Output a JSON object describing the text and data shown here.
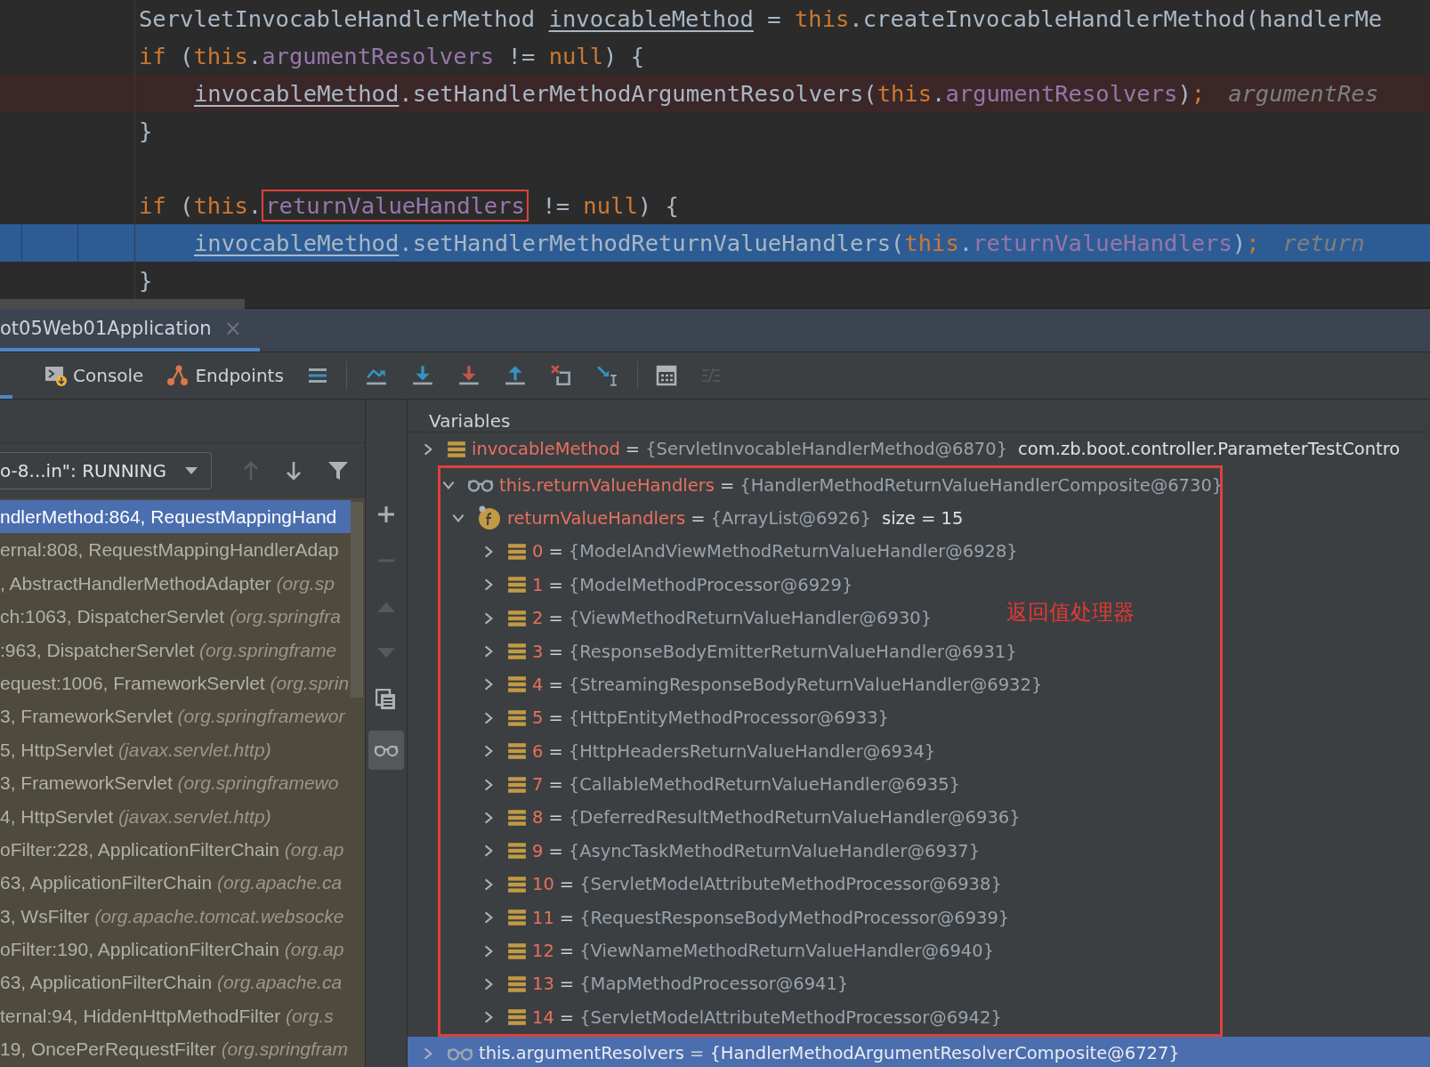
{
  "editor": {
    "lines": [
      {
        "kind": "normal",
        "segments": [
          {
            "kind": "plain",
            "text": "ServletInvocableHandlerMethod "
          },
          {
            "kind": "local",
            "text": "invocableMethod"
          },
          {
            "kind": "plain",
            "text": " = "
          },
          {
            "kind": "keyword",
            "text": "this"
          },
          {
            "kind": "plain",
            "text": ".createInvocableHandlerMethod(handlerMe"
          }
        ]
      },
      {
        "kind": "normal",
        "segments": [
          {
            "kind": "keyword",
            "text": "if"
          },
          {
            "kind": "plain",
            "text": " ("
          },
          {
            "kind": "keyword",
            "text": "this"
          },
          {
            "kind": "plain",
            "text": "."
          },
          {
            "kind": "field",
            "text": "argumentResolvers"
          },
          {
            "kind": "plain",
            "text": " != "
          },
          {
            "kind": "keyword",
            "text": "null"
          },
          {
            "kind": "plain",
            "text": ") {"
          }
        ],
        "children": [
          {
            "kind": "breakpoint",
            "segments": [
              {
                "kind": "local",
                "text": "invocableMethod"
              },
              {
                "kind": "plain",
                "text": ".setHandlerMethodArgumentResolvers("
              },
              {
                "kind": "keyword",
                "text": "this"
              },
              {
                "kind": "plain",
                "text": "."
              },
              {
                "kind": "field",
                "text": "argumentResolvers"
              },
              {
                "kind": "plain",
                "text": ")"
              },
              {
                "kind": "keyword",
                "text": ";"
              },
              {
                "kind": "hint",
                "text": "argumentRes"
              }
            ]
          }
        ]
      },
      {
        "kind": "normal",
        "segments": [
          {
            "kind": "plain",
            "text": "}"
          }
        ]
      },
      {
        "kind": "normal"
      },
      {
        "kind": "normal",
        "segments": [
          {
            "kind": "keyword",
            "text": "if"
          },
          {
            "kind": "plain",
            "text": " ("
          },
          {
            "kind": "keyword",
            "text": "this"
          },
          {
            "kind": "plain",
            "text": "."
          },
          {
            "kind": "boxed-field",
            "text": "returnValueHandlers"
          },
          {
            "kind": "plain",
            "text": " != "
          },
          {
            "kind": "keyword",
            "text": "null"
          },
          {
            "kind": "plain",
            "text": ") {"
          }
        ],
        "children": [
          {
            "kind": "current",
            "segments": [
              {
                "kind": "local",
                "text": "invocableMethod"
              },
              {
                "kind": "plain",
                "text": ".setHandlerMethodReturnValueHandlers("
              },
              {
                "kind": "keyword",
                "text": "this"
              },
              {
                "kind": "plain",
                "text": "."
              },
              {
                "kind": "field",
                "text": "returnValueHandlers"
              },
              {
                "kind": "plain",
                "text": ")"
              },
              {
                "kind": "keyword",
                "text": ";"
              },
              {
                "kind": "hint",
                "text": "return"
              }
            ]
          }
        ]
      },
      {
        "kind": "normal",
        "segments": [
          {
            "kind": "plain",
            "text": "}"
          }
        ]
      }
    ]
  },
  "session_tab": {
    "label": "ot05Web01Application",
    "close": "×",
    "selected": true
  },
  "toolbar": {
    "tabs": [
      {
        "label": "Console"
      },
      {
        "label": "Endpoints"
      }
    ],
    "actions": [
      {
        "disabled": false
      },
      {
        "disabled": false
      },
      {
        "disabled": false
      },
      {
        "disabled": false
      },
      {
        "disabled": false
      },
      {
        "disabled": false
      },
      {
        "disabled": false
      },
      {
        "disabled": false
      },
      {
        "disabled": true
      }
    ]
  },
  "frames": {
    "thread": "o-8...in\": RUNNING",
    "nav": [
      {
        "disabled": true
      },
      {
        "disabled": false
      },
      {
        "disabled": false
      }
    ],
    "rows": [
      {
        "text": "ndlerMethod:864, RequestMappingHand",
        "selected": true
      },
      {
        "text": "ernal:808, RequestMappingHandlerAdap",
        "selected": false
      },
      {
        "text": ", AbstractHandlerMethodAdapter ",
        "package": "(org.sp",
        "selected": false
      },
      {
        "text": "ch:1063, DispatcherServlet ",
        "package": "(org.springfra",
        "selected": false
      },
      {
        "text": ":963, DispatcherServlet ",
        "package": "(org.springframe",
        "selected": false
      },
      {
        "text": "equest:1006, FrameworkServlet ",
        "package": "(org.sprin",
        "selected": false
      },
      {
        "text": "3, FrameworkServlet ",
        "package": "(org.springframewor",
        "selected": false
      },
      {
        "text": "5, HttpServlet ",
        "package": "(javax.servlet.http)",
        "selected": false
      },
      {
        "text": "3, FrameworkServlet ",
        "package": "(org.springframewo",
        "selected": false
      },
      {
        "text": "4, HttpServlet ",
        "package": "(javax.servlet.http)",
        "selected": false
      },
      {
        "text": "oFilter:228, ApplicationFilterChain ",
        "package": "(org.ap",
        "selected": false
      },
      {
        "text": "63, ApplicationFilterChain ",
        "package": "(org.apache.ca",
        "selected": false
      },
      {
        "text": "3, WsFilter ",
        "package": "(org.apache.tomcat.websocke",
        "selected": false
      },
      {
        "text": "oFilter:190, ApplicationFilterChain ",
        "package": "(org.ap",
        "selected": false
      },
      {
        "text": "63, ApplicationFilterChain ",
        "package": "(org.apache.ca",
        "selected": false
      },
      {
        "text": "ternal:94, HiddenHttpMethodFilter ",
        "package": "(org.s",
        "selected": false
      },
      {
        "text": "19, OncePerRequestFilter ",
        "package": "(org.springfram",
        "selected": false
      }
    ]
  },
  "side_toolbar": [
    {
      "disabled": false,
      "on": false
    },
    {
      "disabled": true,
      "on": false
    },
    {
      "disabled": true,
      "on": false
    },
    {
      "disabled": true,
      "on": false
    },
    {
      "disabled": false,
      "on": false
    },
    {
      "disabled": false,
      "on": true
    }
  ],
  "variables": {
    "title": "Variables",
    "annotation": "返回值处理器",
    "items": [
      {
        "kind": "object",
        "name": "invocableMethod",
        "equals": "=",
        "value": "{ServletInvocableHandlerMethod@6870}",
        "extra": "com.zb.boot.controller.ParameterTestContro",
        "expanded": false,
        "selected": false,
        "highlighted": false
      },
      {
        "kind": "watch",
        "name": "this.returnValueHandlers",
        "equals": "=",
        "value": "{HandlerMethodReturnValueHandlerComposite@6730}",
        "expanded": true,
        "selected": false,
        "highlighted": true,
        "children": [
          {
            "kind": "field",
            "name": "returnValueHandlers",
            "equals": "=",
            "value": "{ArrayList@6926}",
            "extra": "size = 15",
            "expanded": true,
            "selected": false,
            "children": [
              {
                "kind": "object",
                "name": "0",
                "equals": "=",
                "value": "{ModelAndViewMethodReturnValueHandler@6928}",
                "expanded": false,
                "selected": false
              },
              {
                "kind": "object",
                "name": "1",
                "equals": "=",
                "value": "{ModelMethodProcessor@6929}",
                "expanded": false,
                "selected": false
              },
              {
                "kind": "object",
                "name": "2",
                "equals": "=",
                "value": "{ViewMethodReturnValueHandler@6930}",
                "expanded": false,
                "selected": false
              },
              {
                "kind": "object",
                "name": "3",
                "equals": "=",
                "value": "{ResponseBodyEmitterReturnValueHandler@6931}",
                "expanded": false,
                "selected": false
              },
              {
                "kind": "object",
                "name": "4",
                "equals": "=",
                "value": "{StreamingResponseBodyReturnValueHandler@6932}",
                "expanded": false,
                "selected": false
              },
              {
                "kind": "object",
                "name": "5",
                "equals": "=",
                "value": "{HttpEntityMethodProcessor@6933}",
                "expanded": false,
                "selected": false
              },
              {
                "kind": "object",
                "name": "6",
                "equals": "=",
                "value": "{HttpHeadersReturnValueHandler@6934}",
                "expanded": false,
                "selected": false
              },
              {
                "kind": "object",
                "name": "7",
                "equals": "=",
                "value": "{CallableMethodReturnValueHandler@6935}",
                "expanded": false,
                "selected": false
              },
              {
                "kind": "object",
                "name": "8",
                "equals": "=",
                "value": "{DeferredResultMethodReturnValueHandler@6936}",
                "expanded": false,
                "selected": false
              },
              {
                "kind": "object",
                "name": "9",
                "equals": "=",
                "value": "{AsyncTaskMethodReturnValueHandler@6937}",
                "expanded": false,
                "selected": false
              },
              {
                "kind": "object",
                "name": "10",
                "equals": "=",
                "value": "{ServletModelAttributeMethodProcessor@6938}",
                "expanded": false,
                "selected": false
              },
              {
                "kind": "object",
                "name": "11",
                "equals": "=",
                "value": "{RequestResponseBodyMethodProcessor@6939}",
                "expanded": false,
                "selected": false
              },
              {
                "kind": "object",
                "name": "12",
                "equals": "=",
                "value": "{ViewNameMethodReturnValueHandler@6940}",
                "expanded": false,
                "selected": false
              },
              {
                "kind": "object",
                "name": "13",
                "equals": "=",
                "value": "{MapMethodProcessor@6941}",
                "expanded": false,
                "selected": false
              },
              {
                "kind": "object",
                "name": "14",
                "equals": "=",
                "value": "{ServletModelAttributeMethodProcessor@6942}",
                "expanded": false,
                "selected": false
              }
            ]
          }
        ]
      },
      {
        "kind": "watch",
        "name": "this.argumentResolvers",
        "equals": "=",
        "value": "{HandlerMethodArgumentResolverComposite@6727}",
        "expanded": false,
        "selected": true,
        "highlighted": false
      }
    ]
  }
}
